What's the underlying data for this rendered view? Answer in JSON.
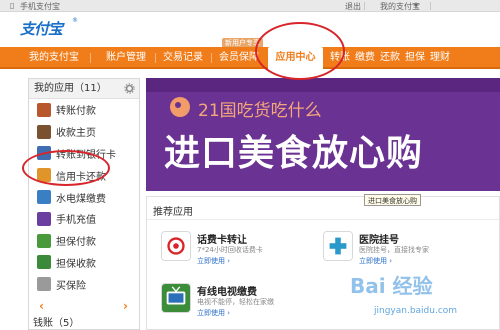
{
  "topbar": {
    "phone_link": "手机支付宝",
    "logout": "退出",
    "my_alipay": "我的支付宝",
    "arrow": "▾"
  },
  "logo": {
    "text": "支付宝",
    "tm": "®"
  },
  "nav": {
    "badge": "新用户专享",
    "items": [
      {
        "label": "我的支付宝"
      },
      {
        "label": "账户管理"
      },
      {
        "label": "交易记录"
      },
      {
        "label": "会员保障"
      },
      {
        "label": "应用中心"
      },
      {
        "label": "转账"
      },
      {
        "label": "缴费"
      },
      {
        "label": "还款"
      },
      {
        "label": "担保"
      },
      {
        "label": "理财"
      }
    ]
  },
  "sidebar": {
    "title": "我的应用（11）",
    "items": [
      {
        "label": "转账付款",
        "icon": "transfer-icon",
        "color": "#b8562c"
      },
      {
        "label": "收款主页",
        "icon": "receive-icon",
        "color": "#7a5230"
      },
      {
        "label": "转账到银行卡",
        "icon": "bank-card-icon",
        "color": "#3f6fb0"
      },
      {
        "label": "信用卡还款",
        "icon": "credit-card-icon",
        "color": "#e0952a"
      },
      {
        "label": "水电煤缴费",
        "icon": "utility-icon",
        "color": "#3a7fc4"
      },
      {
        "label": "手机充值",
        "icon": "phone-icon",
        "color": "#6b3fa0"
      },
      {
        "label": "担保付款",
        "icon": "guarantee-pay-icon",
        "color": "#4a9a3c"
      },
      {
        "label": "担保收款",
        "icon": "guarantee-receive-icon",
        "color": "#3a8a3a"
      },
      {
        "label": "买保险",
        "icon": "insurance-icon",
        "color": "#9a9a9a"
      }
    ],
    "prev": "‹",
    "next": "›",
    "footer": "钱账（5）"
  },
  "banner": {
    "subtitle": "21国吃货吃什么",
    "title": "进口美食放心购",
    "tooltip": "进口美食放心购",
    "colors": {
      "bg": "#6a3293",
      "accent": "#f5a77a"
    }
  },
  "recommended": {
    "title": "推荐应用",
    "apps": [
      {
        "name": "话费卡转让",
        "desc": "7*24小时回收话费卡",
        "use": "立即使用 ›",
        "icon": "china-unicom-icon"
      },
      {
        "name": "医院挂号",
        "desc": "医院挂号，直接找专家",
        "use": "立即使用 ›",
        "icon": "hospital-icon"
      },
      {
        "name": "有线电视缴费",
        "desc": "电视不能停，轻松在家缴",
        "use": "立即使用 ›",
        "icon": "tv-icon"
      }
    ]
  },
  "watermark": {
    "text": "Bai 经验",
    "url": "jingyan.baidu.com"
  },
  "colors": {
    "nav": "#f07d1a",
    "annotation": "#d8252b",
    "link": "#2a6fc9"
  }
}
